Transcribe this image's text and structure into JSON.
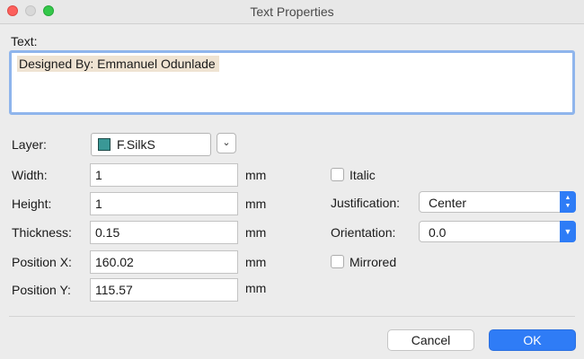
{
  "window": {
    "title": "Text Properties"
  },
  "text_section": {
    "label": "Text:",
    "value": "Designed By: Emmanuel Odunlade"
  },
  "layer": {
    "label": "Layer:",
    "value": "F.SilkS",
    "swatch_color": "#3a9896"
  },
  "fields": {
    "width": {
      "label": "Width:",
      "value": "1",
      "unit": "mm"
    },
    "height": {
      "label": "Height:",
      "value": "1",
      "unit": "mm"
    },
    "thickness": {
      "label": "Thickness:",
      "value": "0.15",
      "unit": "mm"
    },
    "position_x": {
      "label": "Position X:",
      "value": "160.02",
      "unit": "mm"
    },
    "position_y": {
      "label": "Position Y:",
      "value": "115.57",
      "unit": "mm"
    }
  },
  "italic": {
    "label": "Italic",
    "checked": false
  },
  "justification": {
    "label": "Justification:",
    "value": "Center"
  },
  "orientation": {
    "label": "Orientation:",
    "value": "0.0"
  },
  "mirrored": {
    "label": "Mirrored",
    "checked": false
  },
  "buttons": {
    "cancel": "Cancel",
    "ok": "OK"
  },
  "colors": {
    "accent": "#2f7cf6",
    "focus_ring": "#8fb5ec",
    "selection": "#efe3d2"
  }
}
